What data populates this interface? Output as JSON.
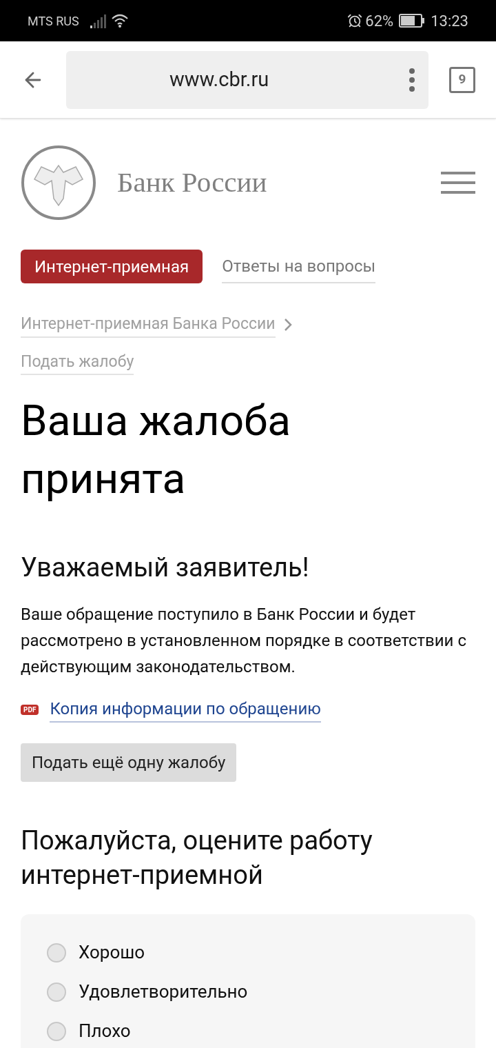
{
  "status_bar": {
    "carrier": "MTS RUS",
    "battery": "62%",
    "time": "13:23"
  },
  "browser": {
    "url": "www.cbr.ru",
    "tab_count": "9"
  },
  "site": {
    "title": "Банк России"
  },
  "tabs": [
    {
      "label": "Интернет-приемная",
      "selected": true
    },
    {
      "label": "Ответы на вопросы",
      "selected": false
    }
  ],
  "breadcrumbs": [
    "Интернет-приемная Банка России",
    "Подать жалобу"
  ],
  "heading": "Ваша жалоба принята",
  "subheading": "Уважаемый заявитель!",
  "message": "Ваше обращение поступило в Банк России и будет рассмотрено в установленном порядке в соответствии с действующим законодательством.",
  "pdf_link": {
    "badge": "PDF",
    "label": "Копия информации по обращению"
  },
  "button": "Подать ещё одну жалобу",
  "rating": {
    "title": "Пожалуйста, оцените работу интернет-приемной",
    "options": [
      {
        "label": "Хорошо",
        "selected": false
      },
      {
        "label": "Удовлетворительно",
        "selected": false
      },
      {
        "label": "Плохо",
        "selected": false
      }
    ]
  }
}
